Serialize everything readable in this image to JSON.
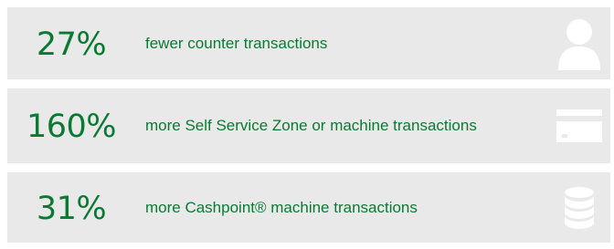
{
  "rows": [
    {
      "stat": "27%",
      "description": "fewer counter transactions",
      "icon": "person-icon"
    },
    {
      "stat": "160%",
      "description": "more Self Service Zone or machine transactions",
      "icon": "card-icon"
    },
    {
      "stat": "31%",
      "description": "more Cashpoint® machine transactions",
      "icon": "coin-stack-icon"
    }
  ],
  "colors": {
    "accent_green": "#0a7a32",
    "row_background": "#e9e9e9",
    "icon_color": "#ffffff"
  }
}
